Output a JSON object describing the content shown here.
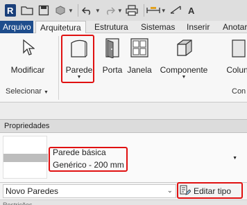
{
  "tabs": [
    "Arquivo",
    "Arquitetura",
    "Estrutura",
    "Sistemas",
    "Inserir",
    "Anotar"
  ],
  "ribbon": {
    "buttons": [
      {
        "label": "Modificar",
        "icon": "cursor-icon"
      },
      {
        "label": "Parede",
        "icon": "wall-icon"
      },
      {
        "label": "Porta",
        "icon": "door-icon"
      },
      {
        "label": "Janela",
        "icon": "window-icon"
      },
      {
        "label": "Componente",
        "icon": "component-icon"
      },
      {
        "label": "Colun",
        "icon": "column-icon"
      }
    ],
    "panels": {
      "select": "Selecionar",
      "build": "Con"
    }
  },
  "properties": {
    "title": "Propriedades",
    "type_family": "Parede básica",
    "type_name": "Genérico - 200 mm",
    "instance_filter": "Novo Paredes",
    "edit_type_label": "Editar tipo",
    "next_row": "Restrições"
  },
  "colors": {
    "highlight": "#e01010",
    "file_tab": "#1e4d8c"
  }
}
